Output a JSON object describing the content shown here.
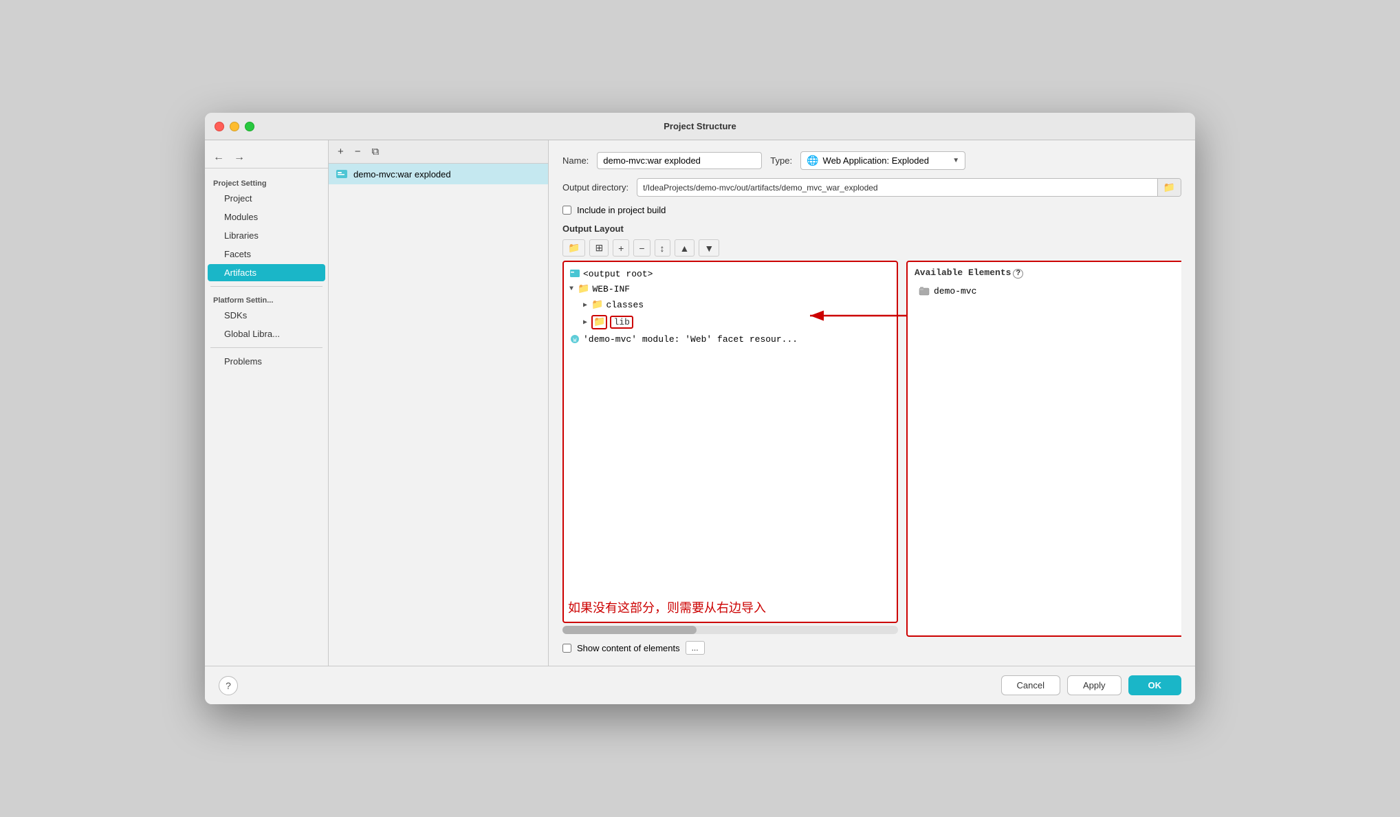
{
  "window": {
    "title": "Project Structure"
  },
  "sidebar": {
    "nav_back": "←",
    "nav_forward": "→",
    "section_project": "Project Setting",
    "items_project": [
      {
        "id": "project",
        "label": "Project"
      },
      {
        "id": "modules",
        "label": "Modules"
      },
      {
        "id": "libraries",
        "label": "Libraries"
      },
      {
        "id": "facets",
        "label": "Facets"
      },
      {
        "id": "artifacts",
        "label": "Artifacts"
      }
    ],
    "section_platform": "Platform Settin...",
    "items_platform": [
      {
        "id": "sdks",
        "label": "SDKs"
      },
      {
        "id": "global-libraries",
        "label": "Global Libra..."
      }
    ],
    "problems": "Problems"
  },
  "artifact_list": {
    "selected_item": "demo-mvc:war exploded",
    "toolbar_buttons": [
      "+",
      "−",
      "⧉"
    ]
  },
  "detail": {
    "name_label": "Name:",
    "name_value": "demo-mvc:war exploded",
    "type_label": "Type:",
    "type_value": "Web Application: Exploded",
    "output_dir_label": "Output directory:",
    "output_dir_value": "t/IdeaProjects/demo-mvc/out/artifacts/demo_mvc_war_exploded",
    "include_label": "Include in project build",
    "output_layout_label": "Output Layout",
    "available_elements_label": "Available Elements",
    "available_elements_help": "?",
    "tree_root": "<output root>",
    "tree_items": [
      {
        "id": "web-inf",
        "label": "WEB-INF",
        "indent": 1,
        "expanded": true,
        "type": "folder"
      },
      {
        "id": "classes",
        "label": "classes",
        "indent": 2,
        "expanded": false,
        "type": "folder"
      },
      {
        "id": "lib",
        "label": "lib",
        "indent": 2,
        "expanded": false,
        "type": "folder",
        "highlighted": true
      },
      {
        "id": "facet-resource",
        "label": "'demo-mvc' module: 'Web' facet resour...",
        "indent": 1,
        "type": "special"
      }
    ],
    "available_items": [
      {
        "label": "demo-mvc"
      }
    ],
    "annotation_text": "如果没有这部分，则需要从右边导入",
    "show_content_label": "Show content of elements",
    "ellipsis_label": "..."
  },
  "bottom": {
    "help_label": "?",
    "cancel_label": "Cancel",
    "apply_label": "Apply",
    "ok_label": "OK"
  }
}
